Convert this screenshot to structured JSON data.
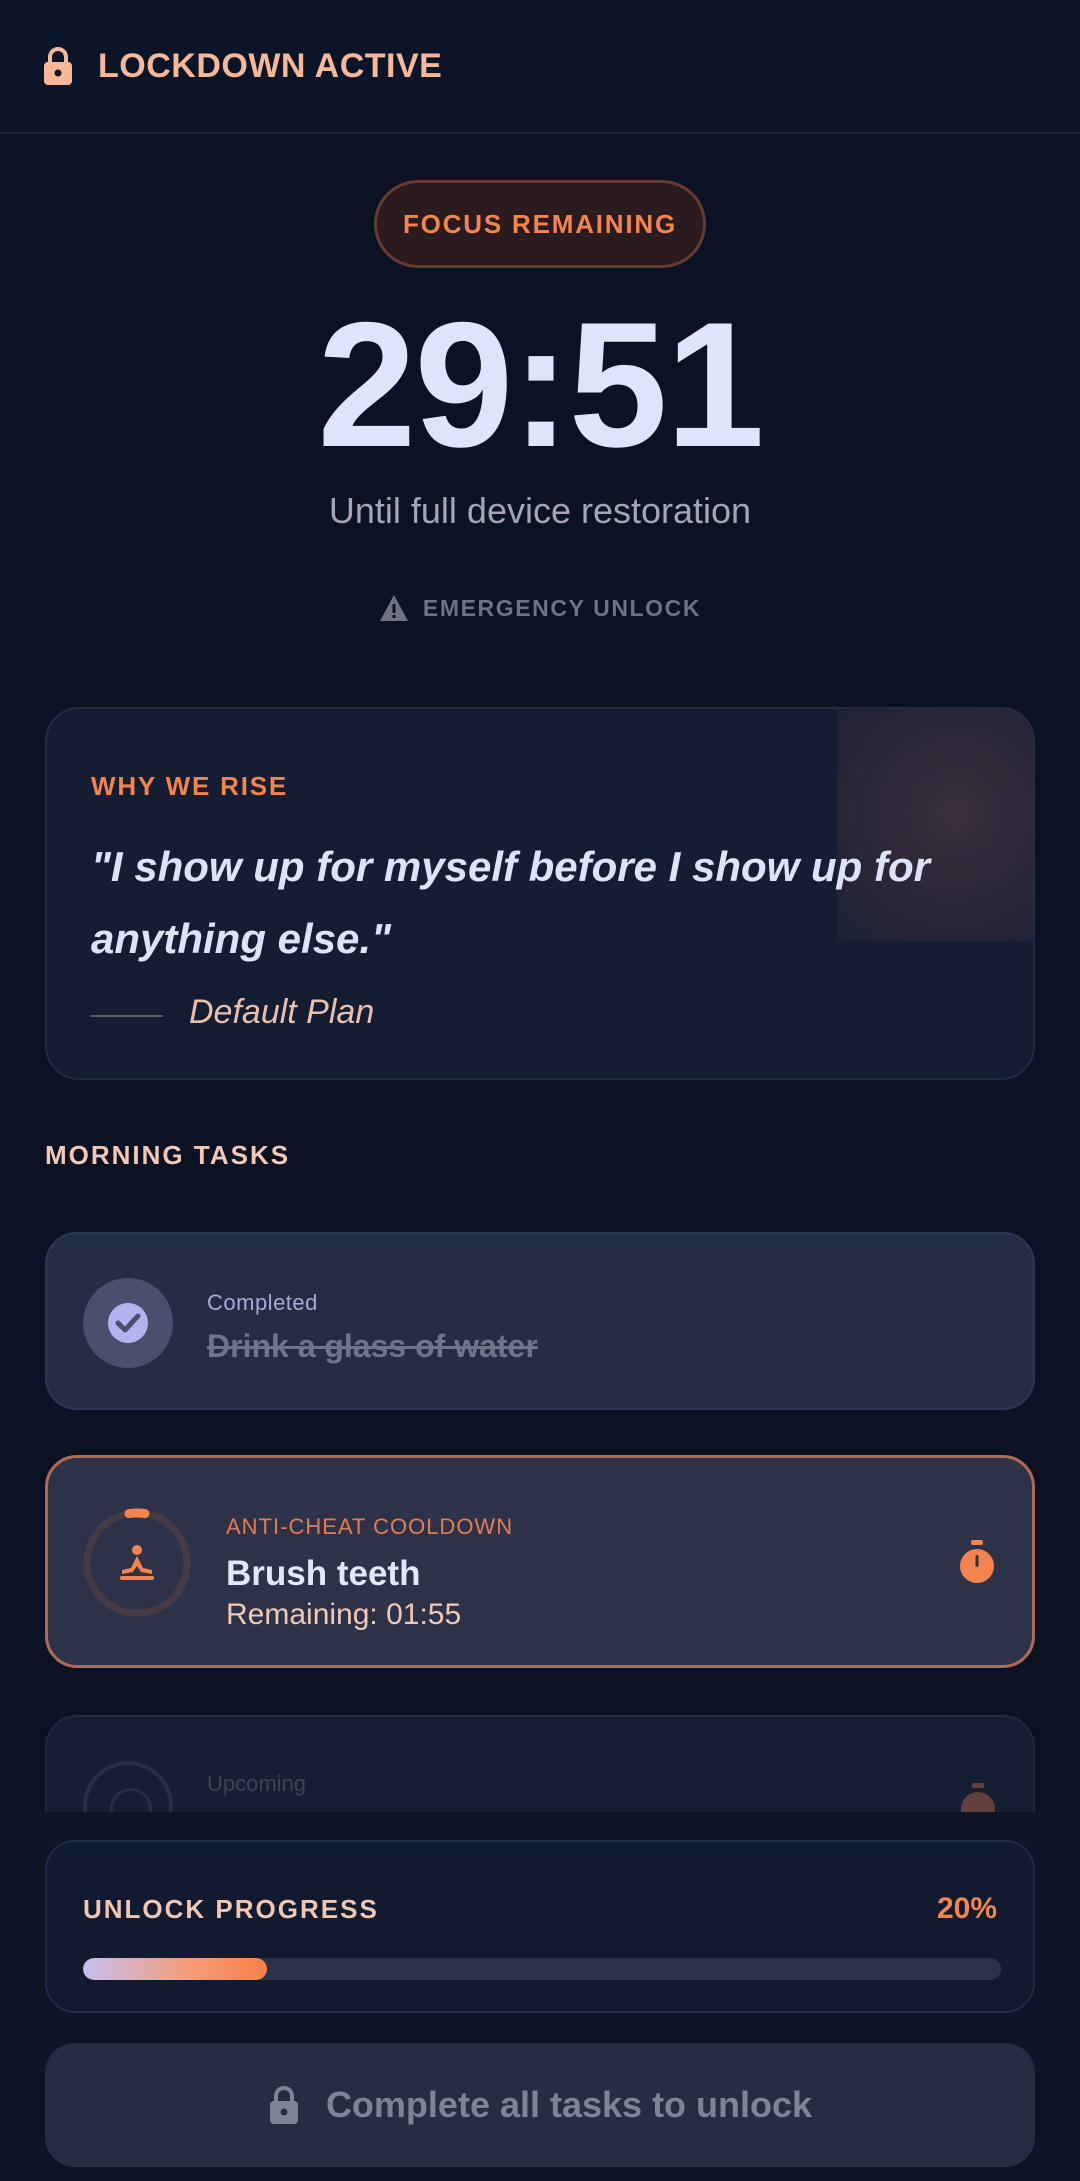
{
  "header": {
    "title": "LOCKDOWN ACTIVE",
    "icon": "lock-icon"
  },
  "focus": {
    "chip_label": "FOCUS REMAINING",
    "timer": "29:51",
    "subtitle": "Until full device restoration",
    "emergency_label": "EMERGENCY UNLOCK"
  },
  "quote_card": {
    "label": "WHY WE RISE",
    "quote": "\"I show up for myself before I show up for anything else.\"",
    "attribution": "Default Plan"
  },
  "tasks_section": {
    "title": "MORNING TASKS",
    "tasks": [
      {
        "status": "Completed",
        "name": "Drink a glass of water",
        "icon": "check-icon"
      },
      {
        "status": "ANTI-CHEAT COOLDOWN",
        "name": "Brush teeth",
        "remaining": "Remaining: 01:55",
        "icon": "meditation-icon",
        "action_icon": "stopwatch-icon"
      },
      {
        "status": "Upcoming",
        "action_icon": "stopwatch-icon"
      }
    ]
  },
  "progress": {
    "label": "UNLOCK PROGRESS",
    "percent_text": "20%",
    "fraction": 0.2
  },
  "unlock_button": {
    "label": "Complete all tasks to unlock",
    "icon": "lock-icon"
  },
  "colors": {
    "background": "#0b1223",
    "accent": "#f3844d",
    "timer_text": "#dfe4fb",
    "completed_check": "#b5b2f0"
  }
}
